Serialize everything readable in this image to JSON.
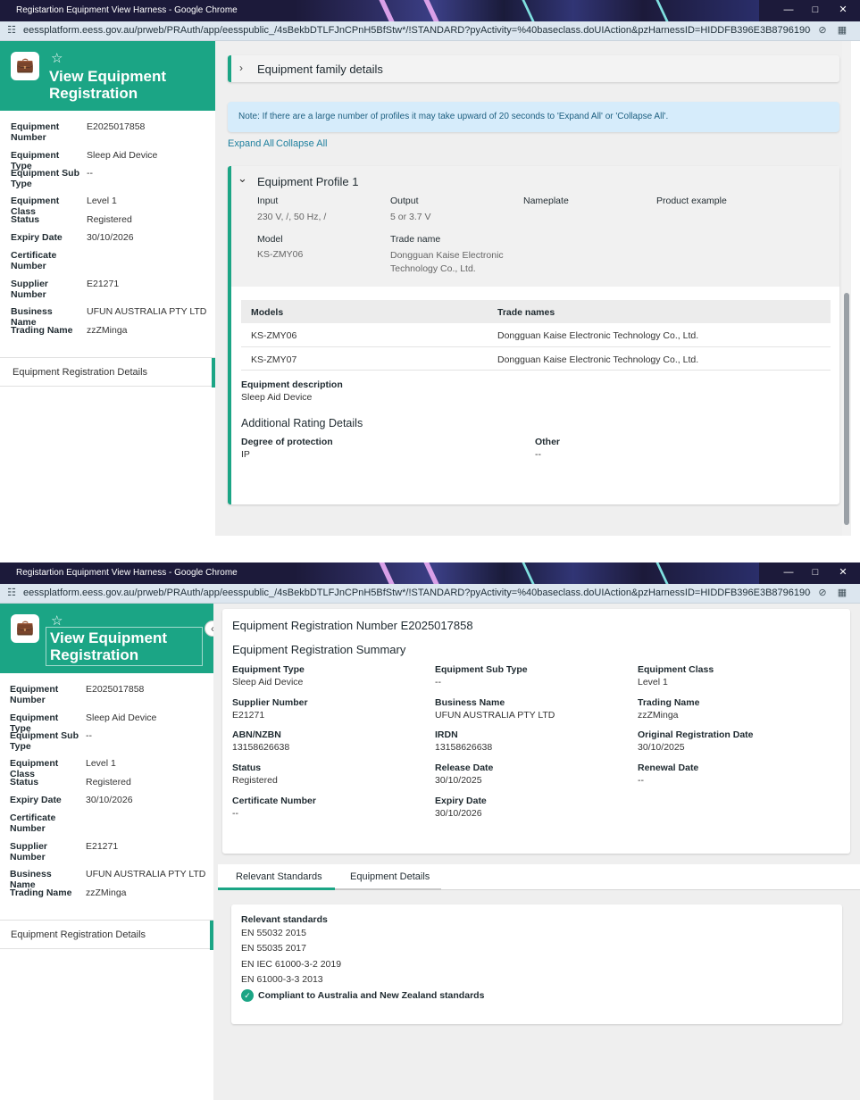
{
  "browser": {
    "window_title": "Registartion Equipment View Harness - Google Chrome",
    "url": "eessplatform.eess.gov.au/prweb/PRAuth/app/eesspublic_/4sBekbDTLFJnCPnH5BfStw*/!STANDARD?pyActivity=%40baseclass.doUIAction&pzHarnessID=HIDDFB396E3B87961906FB21B4EF71..."
  },
  "sidebar": {
    "heading": "View Equipment Registration",
    "fields": [
      {
        "label": "Equipment Number",
        "value": "E2025017858"
      },
      {
        "label": "Equipment Type",
        "value": "Sleep Aid Device"
      },
      {
        "label": "Equipment Sub Type",
        "value": "--"
      },
      {
        "label": "Equipment Class",
        "value": "Level 1"
      },
      {
        "label": "Status",
        "value": "Registered"
      },
      {
        "label": "Expiry Date",
        "value": "30/10/2026"
      },
      {
        "label": "Certificate Number",
        "value": ""
      },
      {
        "label": "Supplier Number",
        "value": "E21271"
      },
      {
        "label": "Business Name",
        "value": "UFUN AUSTRALIA PTY LTD"
      },
      {
        "label": "Trading Name",
        "value": "zzZMinga"
      }
    ],
    "nav_item": "Equipment Registration Details"
  },
  "shot1": {
    "family_details": "Equipment family details",
    "note": "Note: If there are a large number of profiles it may take upward of 20 seconds to 'Expand All' or 'Collapse All'.",
    "expand_all": "Expand All",
    "collapse_all": "Collapse All",
    "profile": {
      "title": "Equipment Profile 1",
      "input_label": "Input",
      "input_value": "230 V, /, 50 Hz, /",
      "output_label": "Output",
      "output_value": "5 or 3.7 V",
      "nameplate_label": "Nameplate",
      "product_example_label": "Product example",
      "model_label": "Model",
      "model_value": "KS-ZMY06",
      "trade_name_label": "Trade name",
      "trade_name_value": "Dongguan Kaise Electronic Technology Co., Ltd."
    },
    "table": {
      "headers": [
        "Models",
        "Trade names"
      ],
      "rows": [
        [
          "KS-ZMY06",
          "Dongguan Kaise Electronic Technology Co., Ltd."
        ],
        [
          "KS-ZMY07",
          "Dongguan Kaise Electronic Technology Co., Ltd."
        ]
      ]
    },
    "description_label": "Equipment description",
    "description_value": "Sleep Aid Device",
    "additional_heading": "Additional Rating Details",
    "protection_label": "Degree of protection",
    "protection_value": "IP",
    "other_label": "Other",
    "other_value": "--"
  },
  "shot2": {
    "reg_number_title": "Equipment Registration Number E2025017858",
    "summary_title": "Equipment Registration Summary",
    "summary": [
      {
        "label": "Equipment Type",
        "value": "Sleep Aid Device"
      },
      {
        "label": "Equipment Sub Type",
        "value": "--"
      },
      {
        "label": "Equipment Class",
        "value": "Level 1"
      },
      {
        "label": "Supplier Number",
        "value": "E21271"
      },
      {
        "label": "Business Name",
        "value": "UFUN AUSTRALIA PTY LTD"
      },
      {
        "label": "Trading Name",
        "value": "zzZMinga"
      },
      {
        "label": "ABN/NZBN",
        "value": "13158626638"
      },
      {
        "label": "IRDN",
        "value": "13158626638"
      },
      {
        "label": "Original Registration Date",
        "value": "30/10/2025"
      },
      {
        "label": "Status",
        "value": "Registered"
      },
      {
        "label": "Release Date",
        "value": "30/10/2025"
      },
      {
        "label": "Renewal Date",
        "value": "--"
      },
      {
        "label": "Certificate Number",
        "value": "--"
      },
      {
        "label": "Expiry Date",
        "value": "30/10/2026"
      }
    ],
    "tabs": [
      "Relevant Standards",
      "Equipment Details"
    ],
    "standards_label": "Relevant standards",
    "standards": [
      "EN 55032 2015",
      "EN 55035 2017",
      "EN IEC 61000-3-2 2019",
      "EN 61000-3-3 2013"
    ],
    "compliance": "Compliant to Australia and New Zealand standards"
  },
  "colors": {
    "brand": "#1ba585",
    "link": "#1d7f9e",
    "note_bg": "#d6ecfb",
    "check": "#1ba585"
  }
}
